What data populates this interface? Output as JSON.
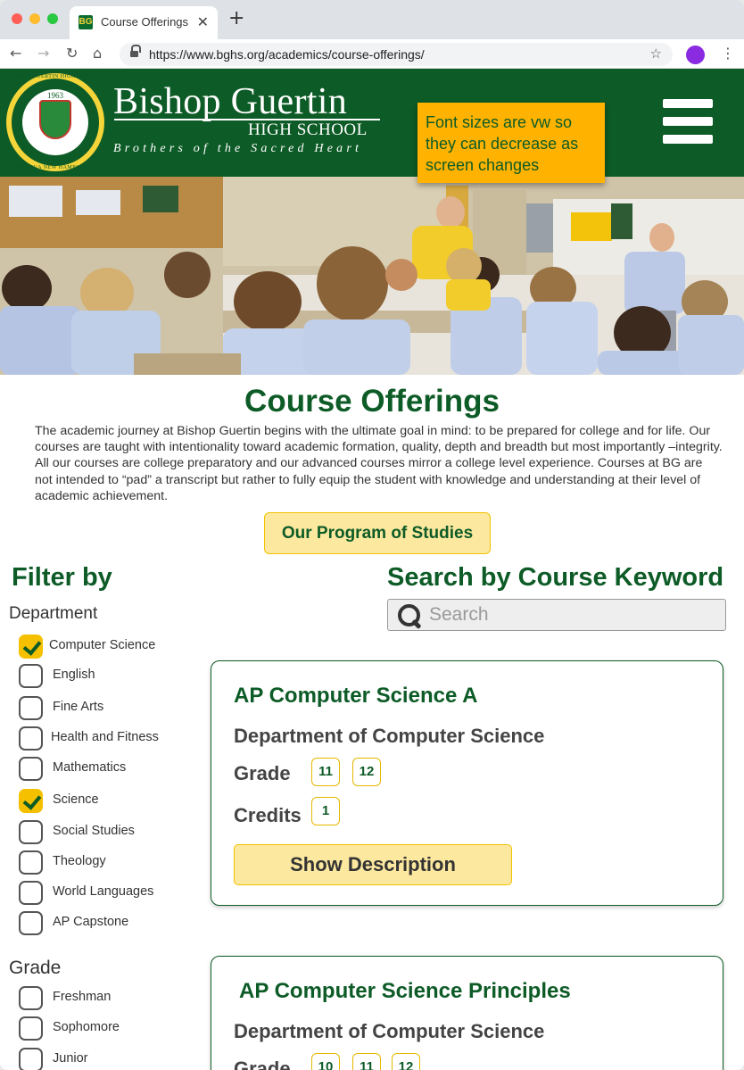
{
  "browser": {
    "tab_title": "Course Offerings",
    "favicon_text": "BG",
    "url": "https://www.bghs.org/academics/course-offerings/"
  },
  "header": {
    "school_name": "Bishop Guertin",
    "school_sub": "HIGH SCHOOL",
    "tagline": "Brothers of the Sacred Heart",
    "seal_year": "1963",
    "seal_ring_top": "BISHOP GUERTIN HIGH SCHOOL",
    "seal_ring_bottom": "NASHUA NEW HAMPSHIRE",
    "brand_color": "#0d5b26",
    "accent_color": "#f5c000"
  },
  "annotation": {
    "text": "Font sizes are vw so they can decrease as screen changes"
  },
  "main": {
    "title": "Course Offerings",
    "intro": "The academic journey at Bishop Guertin begins with the ultimate goal in mind: to be prepared for college and for life. Our courses are taught with intentionality  toward academic formation, quality, depth and breadth but most importantly –integrity. All our courses are college preparatory and our advanced courses mirror a college level experience. Courses at BG are not intended to “pad” a transcript but rather to fully equip the student with knowledge and understanding at their level of academic achievement.",
    "program_button": "Our Program of Studies"
  },
  "filter": {
    "title": "Filter by",
    "department_label": "Department",
    "departments": [
      {
        "label": "Computer Science",
        "checked": true
      },
      {
        "label": "English",
        "checked": false
      },
      {
        "label": "Fine Arts",
        "checked": false
      },
      {
        "label": "Health and Fitness",
        "checked": false
      },
      {
        "label": "Mathematics",
        "checked": false
      },
      {
        "label": "Science",
        "checked": true
      },
      {
        "label": "Social Studies",
        "checked": false
      },
      {
        "label": "Theology",
        "checked": false
      },
      {
        "label": "World Languages",
        "checked": false
      },
      {
        "label": "AP Capstone",
        "checked": false
      }
    ],
    "grade_label": "Grade",
    "grades": [
      {
        "label": "Freshman",
        "checked": false
      },
      {
        "label": "Sophomore",
        "checked": false
      },
      {
        "label": "Junior",
        "checked": false
      }
    ]
  },
  "search": {
    "title": "Search by Course Keyword",
    "placeholder": "Search"
  },
  "courses": [
    {
      "title": "AP Computer Science A",
      "department": "Department of Computer Science",
      "grade_label": "Grade",
      "grades": [
        "11",
        "12"
      ],
      "credits_label": "Credits",
      "credits": "1",
      "button": "Show Description"
    },
    {
      "title": "AP Computer Science Principles",
      "department": "Department of Computer Science",
      "grade_label": "Grade",
      "grades": [
        "10",
        "11",
        "12"
      ]
    }
  ]
}
